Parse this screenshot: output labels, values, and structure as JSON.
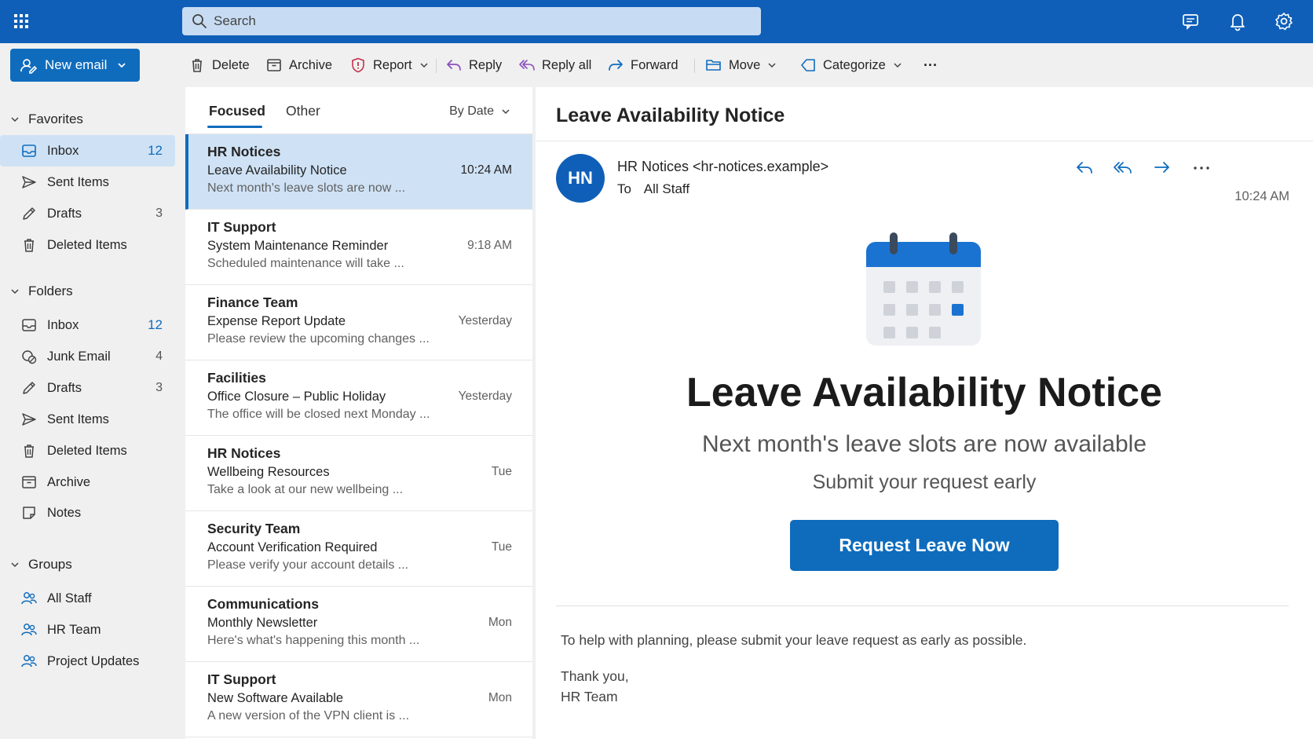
{
  "topbar": {
    "search_placeholder": "Search",
    "icons": [
      "app-launcher-icon",
      "search-icon",
      "feedback-icon",
      "bell-icon",
      "gear-icon"
    ]
  },
  "commands": {
    "new_email": "New email",
    "delete": "Delete",
    "archive": "Archive",
    "report": "Report",
    "reply": "Reply",
    "reply_all": "Reply all",
    "forward": "Forward",
    "move": "Move",
    "categorize": "Categorize",
    "more": "···"
  },
  "nav": {
    "favorites": {
      "label": "Favorites",
      "items": [
        {
          "label": "Inbox",
          "count": "12",
          "icon": "inbox-icon"
        },
        {
          "label": "Sent Items",
          "count": "",
          "icon": "send-icon"
        },
        {
          "label": "Drafts",
          "count": "3",
          "icon": "pencil-icon"
        },
        {
          "label": "Deleted Items",
          "count": "",
          "icon": "trash-icon"
        }
      ]
    },
    "folders": {
      "label": "Folders",
      "items": [
        {
          "label": "Inbox",
          "count": "12",
          "icon": "inbox-icon"
        },
        {
          "label": "Junk Email",
          "count": "4",
          "icon": "junk-icon"
        },
        {
          "label": "Drafts",
          "count": "3",
          "icon": "pencil-icon"
        },
        {
          "label": "Sent Items",
          "count": "",
          "icon": "send-icon"
        },
        {
          "label": "Deleted Items",
          "count": "",
          "icon": "trash-icon"
        },
        {
          "label": "Archive",
          "count": "",
          "icon": "archive-icon"
        },
        {
          "label": "Notes",
          "count": "",
          "icon": "note-icon"
        }
      ]
    },
    "groups": {
      "label": "Groups",
      "items": [
        {
          "label": "All Staff",
          "icon": "people-icon"
        },
        {
          "label": "HR Team",
          "icon": "people-icon"
        },
        {
          "label": "Project Updates",
          "icon": "people-icon"
        }
      ]
    }
  },
  "list": {
    "tabs": [
      "Focused",
      "Other"
    ],
    "sort": "By Date",
    "messages": [
      {
        "from": "HR Notices",
        "subject": "Leave Availability Notice",
        "preview": "Next month's leave slots are now ...",
        "time": "10:24 AM"
      },
      {
        "from": "IT Support",
        "subject": "System Maintenance Reminder",
        "preview": "Scheduled maintenance will take ...",
        "time": "9:18 AM"
      },
      {
        "from": "Finance Team",
        "subject": "Expense Report Update",
        "preview": "Please review the upcoming changes ...",
        "time": "Yesterday"
      },
      {
        "from": "Facilities",
        "subject": "Office Closure – Public Holiday",
        "preview": "The office will be closed next Monday ...",
        "time": "Yesterday"
      },
      {
        "from": "HR Notices",
        "subject": "Wellbeing Resources",
        "preview": "Take a look at our new wellbeing ...",
        "time": "Tue"
      },
      {
        "from": "Security Team",
        "subject": "Account Verification Required",
        "preview": "Please verify your account details ...",
        "time": "Tue"
      },
      {
        "from": "Communications",
        "subject": "Monthly Newsletter",
        "preview": "Here's what's happening this month ...",
        "time": "Mon"
      },
      {
        "from": "IT Support",
        "subject": "New Software Available",
        "preview": "A new version of the VPN client is ...",
        "time": "Mon"
      }
    ]
  },
  "reader": {
    "title": "Leave Availability Notice",
    "avatar": "HN",
    "sender": "HR Notices <hr-notices.example>",
    "to_label": "To",
    "to": "All Staff",
    "time": "10:24 AM",
    "heading": "Leave Availability Notice",
    "subheading": "Next month's leave slots are now available",
    "subheading2": "Submit your request early",
    "cta": "Request Leave Now",
    "body": "To help with planning, please submit your leave request as early as possible.",
    "sign_off": "Thank you,",
    "signature": "HR Team"
  },
  "colors": {
    "brand": "#0f5fb8",
    "accent": "#0f6cbd",
    "selected": "#cfe2f5"
  }
}
